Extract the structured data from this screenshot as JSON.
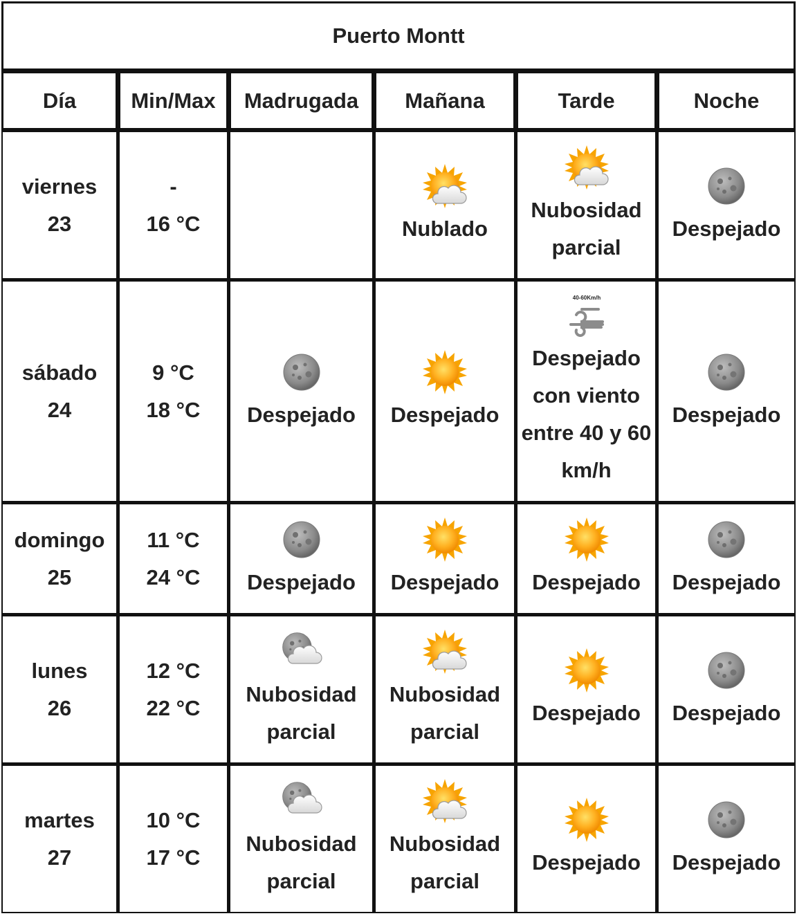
{
  "title": "Puerto Montt",
  "headers": {
    "day": "Día",
    "minmax": "Min/Max",
    "madrugada": "Madrugada",
    "manana": "Mañana",
    "tarde": "Tarde",
    "noche": "Noche"
  },
  "rows": [
    {
      "day_name": "viernes",
      "day_num": "23",
      "min": "-",
      "max": "16 °C",
      "madrugada": {
        "icon": "",
        "text": ""
      },
      "manana": {
        "icon": "sun-cloud-icon",
        "text": "Nublado"
      },
      "tarde": {
        "icon": "sun-cloud-icon",
        "text": "Nubosidad parcial"
      },
      "noche": {
        "icon": "moon-icon",
        "text": "Despejado"
      }
    },
    {
      "day_name": "sábado",
      "day_num": "24",
      "min": "9 °C",
      "max": "18 °C",
      "madrugada": {
        "icon": "moon-icon",
        "text": "Despejado"
      },
      "manana": {
        "icon": "sun-icon",
        "text": "Despejado"
      },
      "tarde": {
        "icon": "wind-icon",
        "icon_label": "40-60Km/h",
        "text": "Despejado con viento entre 40 y 60 km/h"
      },
      "noche": {
        "icon": "moon-icon",
        "text": "Despejado"
      }
    },
    {
      "day_name": "domingo",
      "day_num": "25",
      "min": "11 °C",
      "max": "24 °C",
      "madrugada": {
        "icon": "moon-icon",
        "text": "Despejado"
      },
      "manana": {
        "icon": "sun-icon",
        "text": "Despejado"
      },
      "tarde": {
        "icon": "sun-icon",
        "text": "Despejado"
      },
      "noche": {
        "icon": "moon-icon",
        "text": "Despejado"
      }
    },
    {
      "day_name": "lunes",
      "day_num": "26",
      "min": "12 °C",
      "max": "22 °C",
      "madrugada": {
        "icon": "moon-cloud-icon",
        "text": "Nubosidad parcial"
      },
      "manana": {
        "icon": "sun-cloud-icon",
        "text": "Nubosidad parcial"
      },
      "tarde": {
        "icon": "sun-icon",
        "text": "Despejado"
      },
      "noche": {
        "icon": "moon-icon",
        "text": "Despejado"
      }
    },
    {
      "day_name": "martes",
      "day_num": "27",
      "min": "10 °C",
      "max": "17 °C",
      "madrugada": {
        "icon": "moon-cloud-icon",
        "text": "Nubosidad parcial"
      },
      "manana": {
        "icon": "sun-cloud-icon",
        "text": "Nubosidad parcial"
      },
      "tarde": {
        "icon": "sun-icon",
        "text": "Despejado"
      },
      "noche": {
        "icon": "moon-icon",
        "text": "Despejado"
      }
    }
  ]
}
